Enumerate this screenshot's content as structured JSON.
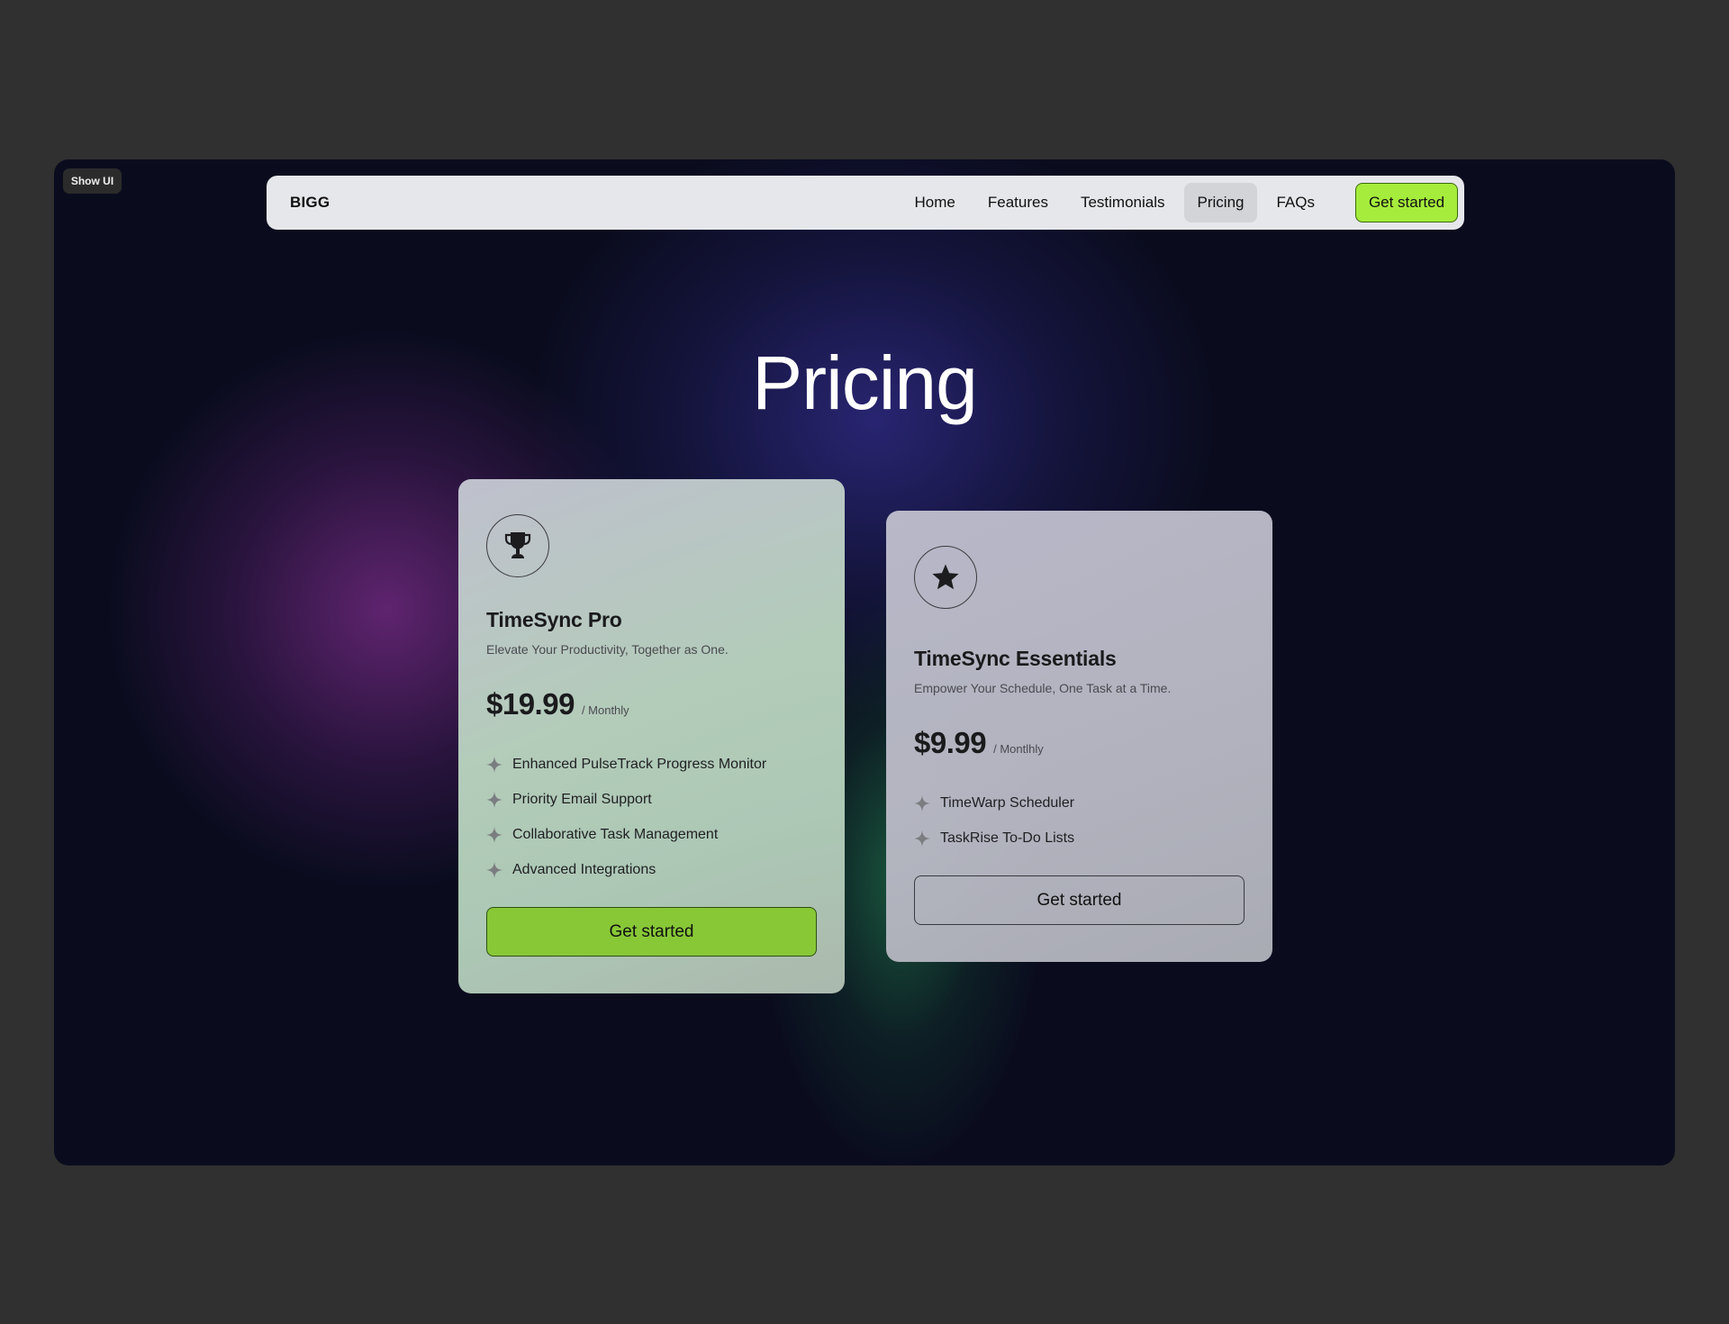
{
  "show_ui_label": "Show UI",
  "nav": {
    "brand": "BIGG",
    "links": [
      {
        "label": "Home",
        "active": false
      },
      {
        "label": "Features",
        "active": false
      },
      {
        "label": "Testimonials",
        "active": false
      },
      {
        "label": "Pricing",
        "active": true
      },
      {
        "label": "FAQs",
        "active": false
      }
    ],
    "cta_label": "Get started"
  },
  "hero": {
    "title": "Pricing"
  },
  "plans": [
    {
      "icon": "trophy-icon",
      "name": "TimeSync Pro",
      "tagline": "Elevate Your Productivity, Together as One.",
      "price": "$19.99",
      "period": "/ Monthly",
      "features": [
        "Enhanced PulseTrack Progress Monitor",
        "Priority Email Support",
        "Collaborative Task Management",
        "Advanced Integrations"
      ],
      "cta_label": "Get started",
      "highlighted": true
    },
    {
      "icon": "star-icon",
      "name": "TimeSync Essentials",
      "tagline": "Empower Your Schedule, One Task at a Time.",
      "price": "$9.99",
      "period": "/ Montlhly",
      "features": [
        "TimeWarp Scheduler",
        "TaskRise To-Do Lists"
      ],
      "cta_label": "Get started",
      "highlighted": false
    }
  ],
  "colors": {
    "page_bg": "#303030",
    "frame_bg": "#0a0c1e",
    "accent_green": "#a6ec3c",
    "button_green": "#88c837",
    "navbar_bg": "#e6e7ea"
  }
}
